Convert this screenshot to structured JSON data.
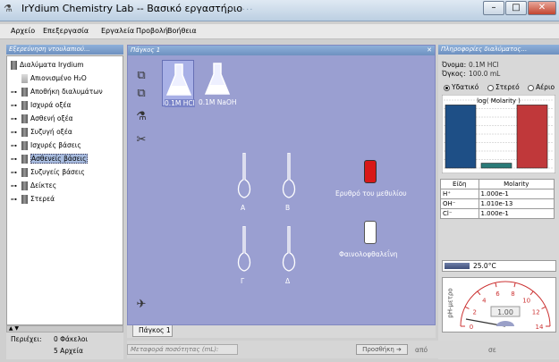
{
  "window": {
    "title": "IrYdium Chemistry Lab -- Βασικό εργαστήριο",
    "bg_text": "........"
  },
  "menu": [
    "Αρχείο",
    "Επεξεργασία",
    "Εργαλεία",
    "Προβολή",
    "Βοήθεια"
  ],
  "explorer": {
    "header": "Εξερεύνηση ντουλαπιού...",
    "items": [
      {
        "label": "Διαλύματα Irydium",
        "indent": 0
      },
      {
        "label": "Απιονισμένο H₂O",
        "indent": 1
      },
      {
        "label": "Αποθήκη διαλυμάτων",
        "indent": 1
      },
      {
        "label": "Ισχυρά οξέα",
        "indent": 1
      },
      {
        "label": "Ασθενή οξέα",
        "indent": 1
      },
      {
        "label": "Συζυγή οξέα",
        "indent": 1
      },
      {
        "label": "Ισχυρές βάσεις",
        "indent": 1
      },
      {
        "label": "Ασθενείς βάσεις",
        "indent": 1,
        "selected": true
      },
      {
        "label": "Συζυγείς βάσεις",
        "indent": 1
      },
      {
        "label": "Δείκτες",
        "indent": 1
      },
      {
        "label": "Στερεά",
        "indent": 1
      }
    ],
    "contains_label": "Περιέχει:",
    "folders": "0 Φάκελοι",
    "files": "5 Αρχεία"
  },
  "workbench": {
    "header": "Πάγκος 1",
    "flasks": [
      {
        "label": "0.1M HCl"
      },
      {
        "label": "0.1M NaOH"
      }
    ],
    "vol_flasks": [
      "Α",
      "Β",
      "Γ",
      "Δ"
    ],
    "bottles": [
      {
        "label": "Ερυθρό του μεθυλίου",
        "color": "#d81818"
      },
      {
        "label": "Φαινολοφθαλεΐνη",
        "color": "#ffffff"
      }
    ],
    "tab_label": "Πάγκος 1"
  },
  "info": {
    "header": "Πληροφορίες διαλύματος...",
    "name_label": "Όνομα:",
    "name_value": "0.1M HCl",
    "volume_label": "Όγκος:",
    "volume_value": "100.0 mL",
    "phases": [
      "Υδατικό",
      "Στερεό",
      "Αέριο"
    ],
    "selected_phase": "Υδατικό",
    "table_headers": [
      "Είδη",
      "Molarity"
    ],
    "table_rows": [
      [
        "H⁺",
        "1.000e-1"
      ],
      [
        "OH⁻",
        "1.010e-13"
      ],
      [
        "Cl⁻",
        "1.000e-1"
      ]
    ],
    "temperature": "25.0°C",
    "ph_label": "pH-μετρο",
    "ph_value": "1.00",
    "ph_ticks": [
      "0",
      "2",
      "4",
      "6",
      "8",
      "10",
      "12",
      "14"
    ]
  },
  "chart_data": {
    "type": "bar",
    "title": "log( Molarity )",
    "categories": [
      "H⁺",
      "OH⁻",
      "Cl⁻"
    ],
    "values": [
      -1.0,
      -12.996,
      -1.0
    ],
    "colors": [
      "#1e4f86",
      "#2a7a78",
      "#c0383a"
    ]
  },
  "statusbar": {
    "transfer_placeholder": "Μεταφορά ποσότητας (mL):",
    "add_button": "Προσθήκη",
    "from_label": "από",
    "to_label": "σε"
  }
}
